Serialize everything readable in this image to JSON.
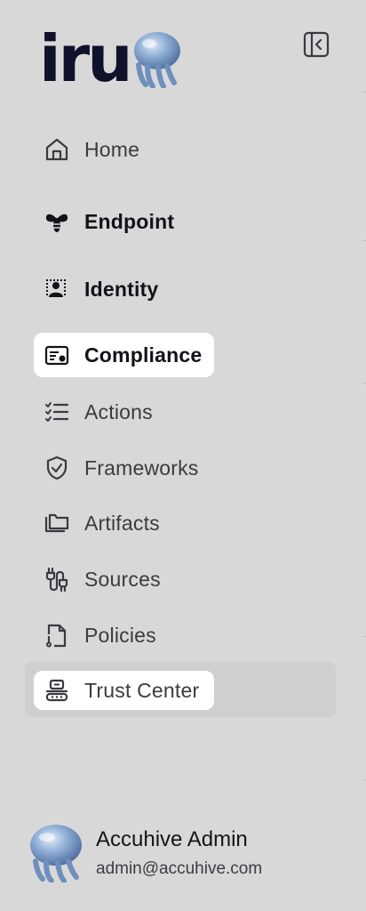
{
  "brand": {
    "logo_text": "iru"
  },
  "nav": {
    "home": "Home",
    "endpoint": "Endpoint",
    "identity": "Identity",
    "compliance": "Compliance",
    "actions": "Actions",
    "frameworks": "Frameworks",
    "artifacts": "Artifacts",
    "sources": "Sources",
    "policies": "Policies",
    "trust_center": "Trust Center"
  },
  "user": {
    "name": "Accuhive Admin",
    "email": "admin@accuhive.com"
  },
  "icons": {
    "collapse": "sidebar-collapse-icon",
    "home": "home-icon",
    "endpoint": "bee-icon",
    "identity": "identity-icon",
    "compliance": "compliance-icon",
    "actions": "checklist-icon",
    "frameworks": "shield-check-icon",
    "artifacts": "folder-icon",
    "sources": "plug-icon",
    "policies": "document-icon",
    "trust_center": "trust-center-icon"
  },
  "colors": {
    "background": "#d8d8d9",
    "active_pill": "#ffffff",
    "logo": "#10112a"
  }
}
